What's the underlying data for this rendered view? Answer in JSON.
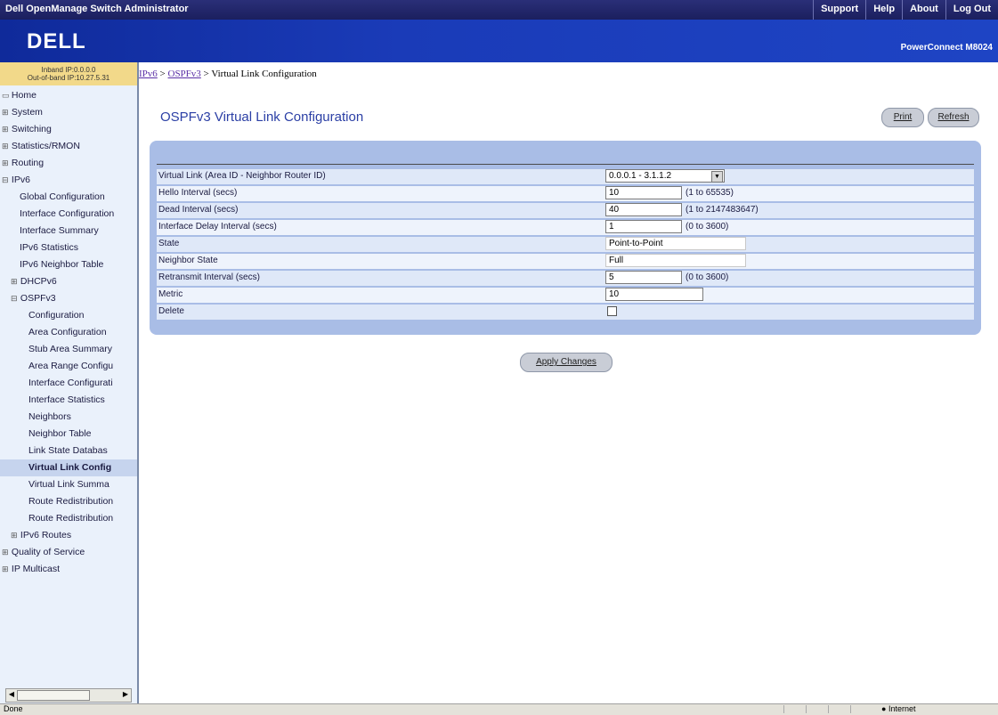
{
  "window": {
    "app_title": "Dell OpenManage Switch Administrator",
    "top_links": [
      "Support",
      "Help",
      "About",
      "Log Out"
    ]
  },
  "banner": {
    "logo": "DELL",
    "product": "PowerConnect M8024"
  },
  "ip_info": {
    "inband": "Inband IP:0.0.0.0",
    "outofband": "Out-of-band IP:10.27.5.31"
  },
  "tree": [
    {
      "label": "Home",
      "icon": "home-icon",
      "prefix": "▭",
      "level": 0
    },
    {
      "label": "System",
      "prefix": "⊞",
      "level": 0
    },
    {
      "label": "Switching",
      "prefix": "⊞",
      "level": 0
    },
    {
      "label": "Statistics/RMON",
      "prefix": "⊞",
      "level": 0
    },
    {
      "label": "Routing",
      "prefix": "⊞",
      "level": 0
    },
    {
      "label": "IPv6",
      "prefix": "⊟",
      "level": 0
    },
    {
      "label": "Global Configuration",
      "prefix": "",
      "level": 2
    },
    {
      "label": "Interface Configuration",
      "prefix": "",
      "level": 2
    },
    {
      "label": "Interface Summary",
      "prefix": "",
      "level": 2
    },
    {
      "label": "IPv6 Statistics",
      "prefix": "",
      "level": 2
    },
    {
      "label": "IPv6 Neighbor Table",
      "prefix": "",
      "level": 2
    },
    {
      "label": "DHCPv6",
      "prefix": "⊞",
      "level": 1
    },
    {
      "label": "OSPFv3",
      "prefix": "⊟",
      "level": 1
    },
    {
      "label": "Configuration",
      "prefix": "",
      "level": 3
    },
    {
      "label": "Area Configuration",
      "prefix": "",
      "level": 3
    },
    {
      "label": "Stub Area Summary",
      "prefix": "",
      "level": 3
    },
    {
      "label": "Area Range Configu",
      "prefix": "",
      "level": 3
    },
    {
      "label": "Interface Configurati",
      "prefix": "",
      "level": 3
    },
    {
      "label": "Interface Statistics",
      "prefix": "",
      "level": 3
    },
    {
      "label": "Neighbors",
      "prefix": "",
      "level": 3
    },
    {
      "label": "Neighbor Table",
      "prefix": "",
      "level": 3
    },
    {
      "label": "Link State Databas",
      "prefix": "",
      "level": 3
    },
    {
      "label": "Virtual Link Config",
      "prefix": "",
      "level": 3,
      "selected": true
    },
    {
      "label": "Virtual Link Summa",
      "prefix": "",
      "level": 3
    },
    {
      "label": "Route Redistribution",
      "prefix": "",
      "level": 3
    },
    {
      "label": "Route Redistribution",
      "prefix": "",
      "level": 3
    },
    {
      "label": "IPv6 Routes",
      "prefix": "⊞",
      "level": 1
    },
    {
      "label": "Quality of Service",
      "prefix": "⊞",
      "level": 0
    },
    {
      "label": "IP Multicast",
      "prefix": "⊞",
      "level": 0
    }
  ],
  "breadcrumb": {
    "link1": "IPv6",
    "sep": " > ",
    "link2": "OSPFv3",
    "current": "Virtual Link Configuration"
  },
  "page": {
    "title": "OSPFv3 Virtual Link Configuration",
    "print_label": "Print",
    "refresh_label": "Refresh",
    "apply_label": "Apply Changes"
  },
  "form": {
    "virtual_link": {
      "label": "Virtual Link (Area ID - Neighbor Router ID)",
      "value": "0.0.0.1 - 3.1.1.2"
    },
    "hello": {
      "label": "Hello Interval (secs)",
      "value": "10",
      "range": "(1 to 65535)"
    },
    "dead": {
      "label": "Dead Interval (secs)",
      "value": "40",
      "range": "(1 to 2147483647)"
    },
    "delay": {
      "label": "Interface Delay Interval (secs)",
      "value": "1",
      "range": "(0 to 3600)"
    },
    "state": {
      "label": "State",
      "value": "Point-to-Point"
    },
    "neighbor_state": {
      "label": "Neighbor State",
      "value": "Full"
    },
    "retransmit": {
      "label": "Retransmit Interval (secs)",
      "value": "5",
      "range": "(0 to 3600)"
    },
    "metric": {
      "label": "Metric",
      "value": "10"
    },
    "delete": {
      "label": "Delete",
      "checked": false
    }
  },
  "statusbar": {
    "left": "Done",
    "zone": "Internet"
  },
  "colors": {
    "accent": "#2b3fa5",
    "panel": "#a9bde6",
    "banner": "#1a3bb8"
  }
}
